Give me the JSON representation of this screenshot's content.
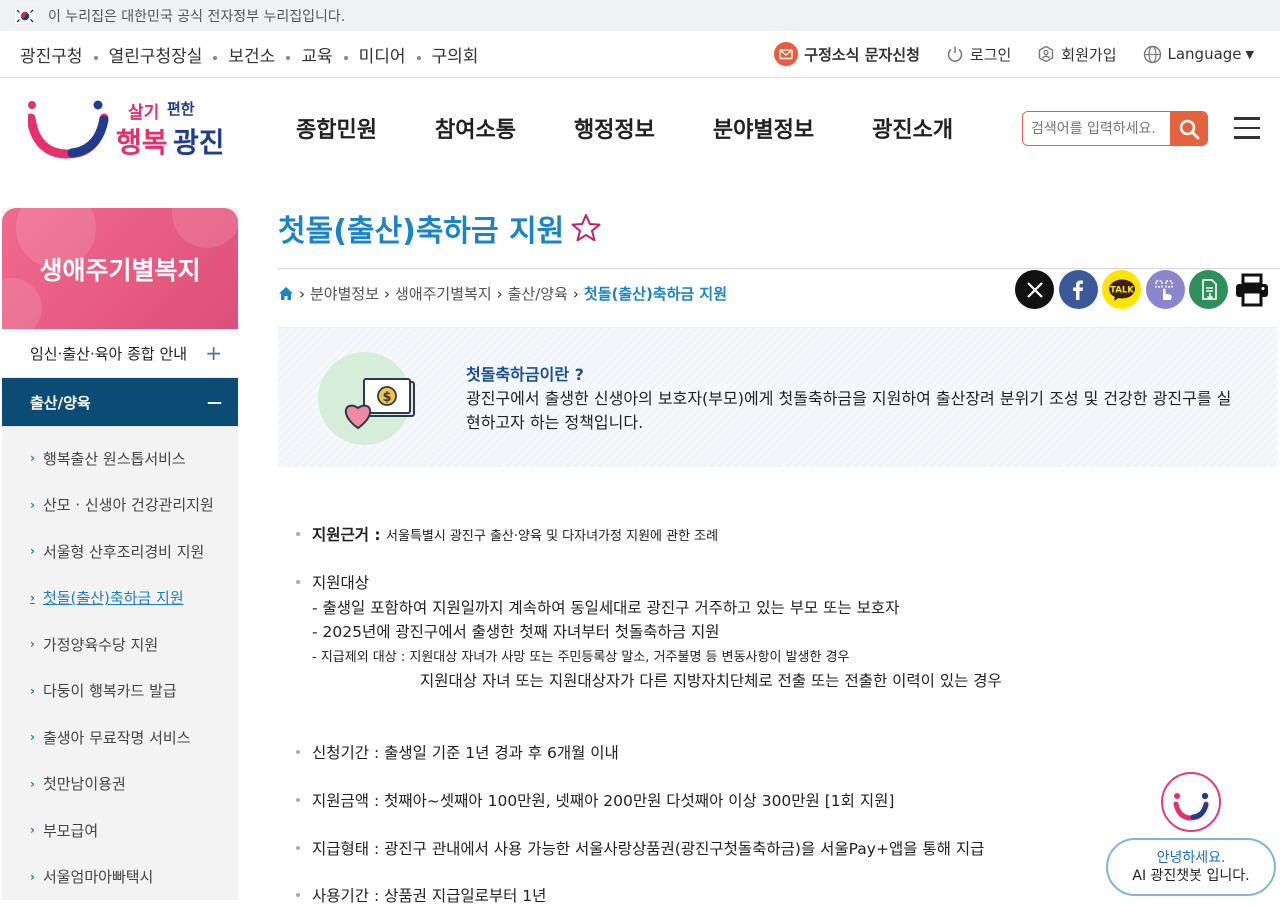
{
  "gov_banner": {
    "text": "이 누리집은 대한민국 공식 전자정부 누리집입니다."
  },
  "util": {
    "links": [
      "광진구청",
      "열린구청장실",
      "보건소",
      "교육",
      "미디어",
      "구의회"
    ],
    "sms": "구정소식 문자신청",
    "login": "로그인",
    "join": "회원가입",
    "language": "Language"
  },
  "header": {
    "logo_text_top": "살기편한",
    "logo_text_bottom": "행복광진",
    "gnb": [
      "종합민원",
      "참여소통",
      "행정정보",
      "분야별정보",
      "광진소개"
    ],
    "search_placeholder": "검색어를 입력하세요."
  },
  "sidebar": {
    "title": "생애주기별복지",
    "section1": "임신·출산·육아 종합 안내",
    "section1_toggle": "+",
    "section2": "출산/양육",
    "section2_toggle": "—",
    "items": [
      "행복출산 원스톱서비스",
      "산모 · 신생아 건강관리지원",
      "서울형 산후조리경비 지원",
      "첫돌(출산)축하금 지원",
      "가정양육수당 지원",
      "다둥이 행복카드 발급",
      "출생아 무료작명 서비스",
      "첫만남이용권",
      "부모급여",
      "서울엄마아빠택시"
    ]
  },
  "content": {
    "title": "첫돌(출산)축하금 지원",
    "breadcrumb": [
      "분야별정보",
      "생애주기별복지",
      "출산/양육"
    ],
    "breadcrumb_current": "첫돌(출산)축하금 지원",
    "intro_q": "첫돌축하금이란 ?",
    "intro_desc": "광진구에서 출생한 신생아의 보호자(부모)에게  첫돌축하금을 지원하여 출산장려 분위기 조성 및 건강한 광진구를 실현하고자 하는 정책입니다.",
    "basis_label": "지원근거 : ",
    "basis_text": "서울특별시 광진구 출산·양육 및 다자녀가정 지원에 관한 조례",
    "target_label": "지원대상",
    "target_1": "- 출생일 포함하여 지원일까지 계속하여 동일세대로 광진구 거주하고 있는 부모 또는 보호자",
    "target_2": "- 2025년에 광진구에서 출생한 첫째 자녀부터 첫돌축하금 지원",
    "target_3": "- 지급제외 대상 : 지원대상 자녀가 사망 또는 주민등록상 말소, 거주불명 등 변동사항이 발생한 경우",
    "target_4": "지원대상 자녀 또는 지원대상자가 다른 지방자치단체로 전출 또는 전출한 이력이 있는 경우",
    "period": "신청기간 : 출생일 기준 1년 경과 후 6개월 이내",
    "amount": "지원금액 : 첫째아~셋째아 100만원, 넷째아 200만원 다섯째아 이상 300만원 [1회 지원]",
    "form": "지급형태 : 광진구 관내에서 사용 가능한 서울사랑상품권(광진구첫돌축하금)을 서울Pay+앱을 통해 지급",
    "usage": "사용기간 : 상품권 지급일로부터 1년"
  },
  "chatbot": {
    "line1": "안녕하세요.",
    "line2": "AI 광진챗봇 입니다."
  },
  "colors": {
    "accent_blue": "#1b84c4",
    "sidebar_active": "#0c4b73",
    "search_orange": "#e6613e",
    "sidebar_pink": "#e65a80"
  }
}
